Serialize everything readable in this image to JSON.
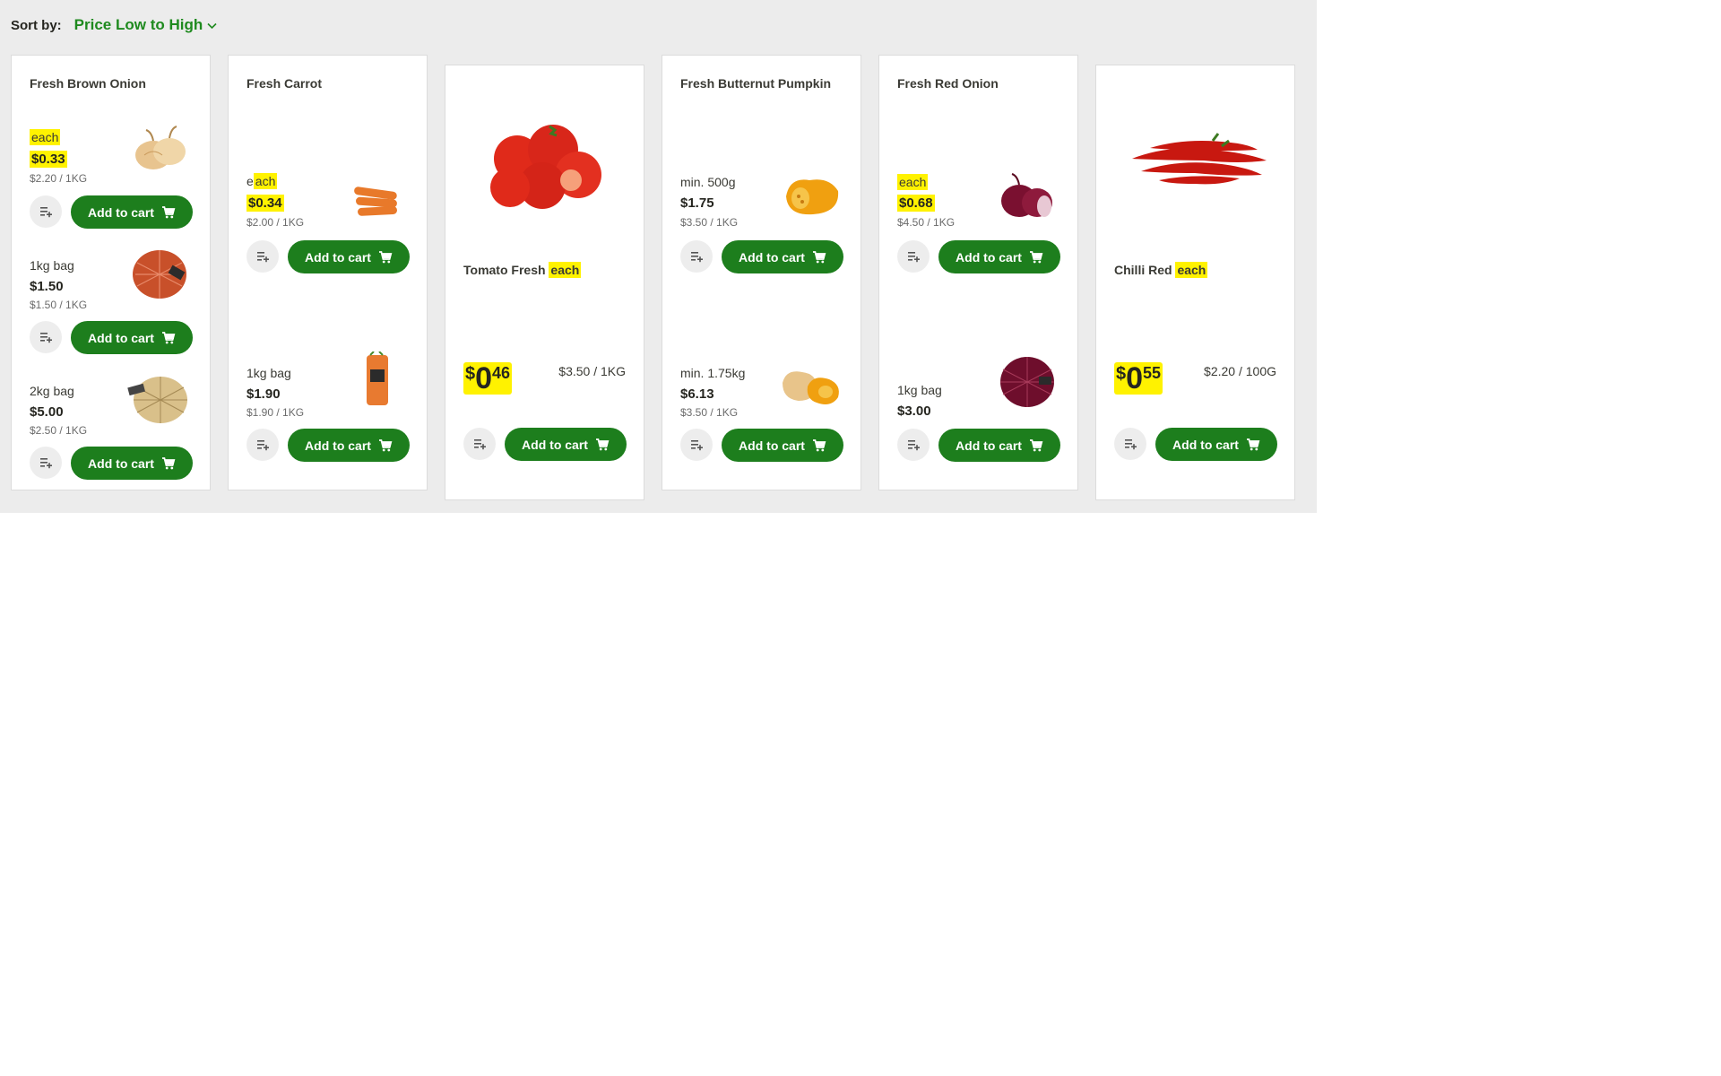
{
  "sort": {
    "label": "Sort by:",
    "value": "Price Low to High"
  },
  "buttons": {
    "add_to_cart": "Add to cart"
  },
  "colors": {
    "brand_green": "#1d7e1d",
    "sort_green": "#1f8a1f",
    "highlight": "#fff200",
    "panel_bg": "#ececec"
  },
  "icons": {
    "list": "add-to-list-icon",
    "cart": "cart-icon",
    "chevron": "chevron-down-icon"
  },
  "products": [
    {
      "name": "Fresh Brown Onion",
      "variants": [
        {
          "unit": "each",
          "price": "$0.33",
          "cup": "$2.20 / 1KG",
          "highlighted": true,
          "image": "brown-onion-icon"
        },
        {
          "unit": "1kg bag",
          "price": "$1.50",
          "cup": "$1.50 / 1KG",
          "highlighted": false,
          "image": "brown-onion-bag-icon"
        },
        {
          "unit": "2kg bag",
          "price": "$5.00",
          "cup": "$2.50 / 1KG",
          "highlighted": false,
          "image": "brown-onion-bag-2kg-icon"
        }
      ]
    },
    {
      "name": "Fresh Carrot",
      "variants": [
        {
          "unit_prefix": "e",
          "unit_highlight": "ach",
          "price": "$0.34",
          "cup": "$2.00 / 1KG",
          "highlighted": true,
          "image": "carrot-icon"
        },
        {
          "unit": "1kg bag",
          "price": "$1.90",
          "cup": "$1.90 / 1KG",
          "highlighted": false,
          "image": "carrot-bag-icon"
        }
      ]
    },
    {
      "name_prefix": "Tomato Fresh",
      "name_suffix": "each",
      "price_dollar": "$",
      "price_int": "0",
      "price_cents": "46",
      "cup": "$3.50 / 1KG",
      "image": "tomato-icon"
    },
    {
      "name": "Fresh Butternut Pumpkin",
      "variants": [
        {
          "unit": "min. 500g",
          "price": "$1.75",
          "cup": "$3.50 / 1KG",
          "highlighted": false,
          "image": "butternut-half-icon"
        },
        {
          "unit": "min. 1.75kg",
          "price": "$6.13",
          "cup": "$3.50 / 1KG",
          "highlighted": false,
          "image": "butternut-whole-icon"
        }
      ]
    },
    {
      "name": "Fresh Red Onion",
      "variants": [
        {
          "unit": "each",
          "price": "$0.68",
          "cup": "$4.50 / 1KG",
          "highlighted": true,
          "image": "red-onion-icon"
        },
        {
          "unit": "1kg bag",
          "price": "$3.00",
          "cup": "",
          "highlighted": false,
          "image": "red-onion-bag-icon"
        }
      ]
    },
    {
      "name_prefix": "Chilli Red",
      "name_suffix": "each",
      "price_dollar": "$",
      "price_int": "0",
      "price_cents": "55",
      "cup": "$2.20 / 100G",
      "image": "chilli-icon"
    }
  ]
}
